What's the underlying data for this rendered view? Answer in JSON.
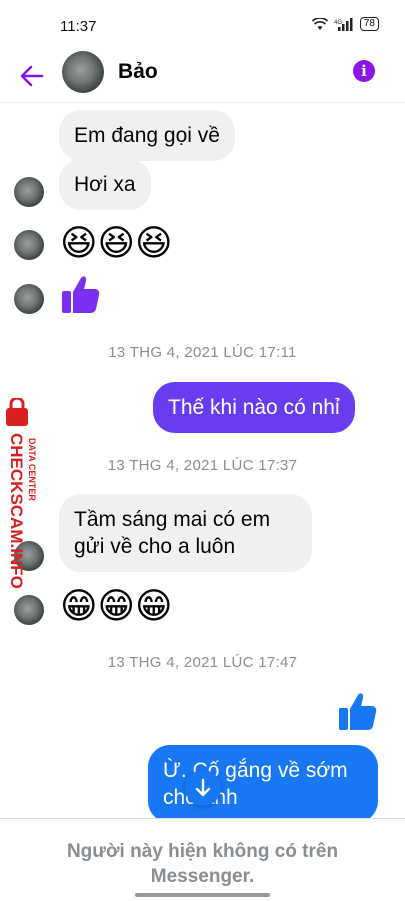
{
  "status": {
    "time": "11:37",
    "battery": "78"
  },
  "header": {
    "contact_name": "Bảo"
  },
  "messages": [
    {
      "text": "Em đang gọi về"
    },
    {
      "text": "Hơi xa"
    },
    {
      "emoji": "😆😆😆"
    },
    {
      "emoji": "👍"
    },
    {
      "timestamp": "13 THG 4, 2021 LÚC 17:11"
    },
    {
      "text": "Thế khi nào có nhỉ"
    },
    {
      "timestamp": "13 THG 4, 2021 LÚC 17:37"
    },
    {
      "text": "Tầm sáng mai có em gửi về cho a luôn"
    },
    {
      "emoji": "😁😁😁"
    },
    {
      "timestamp": "13 THG 4, 2021 LÚC 17:47"
    },
    {
      "emoji": "👍"
    },
    {
      "text": "Ừ. Cố gắng về sớm cho anh"
    }
  ],
  "watermark": {
    "title": "CHECKSCAM.INFO",
    "subtitle": "DATA CENTER"
  },
  "footer": {
    "notice": "Người này hiện không có trên Messenger."
  },
  "colors": {
    "accent": "#8a16e6",
    "sent_purple": "#6a3cf0",
    "sent_blue": "#1877f2",
    "incoming": "#f0f0f0"
  }
}
